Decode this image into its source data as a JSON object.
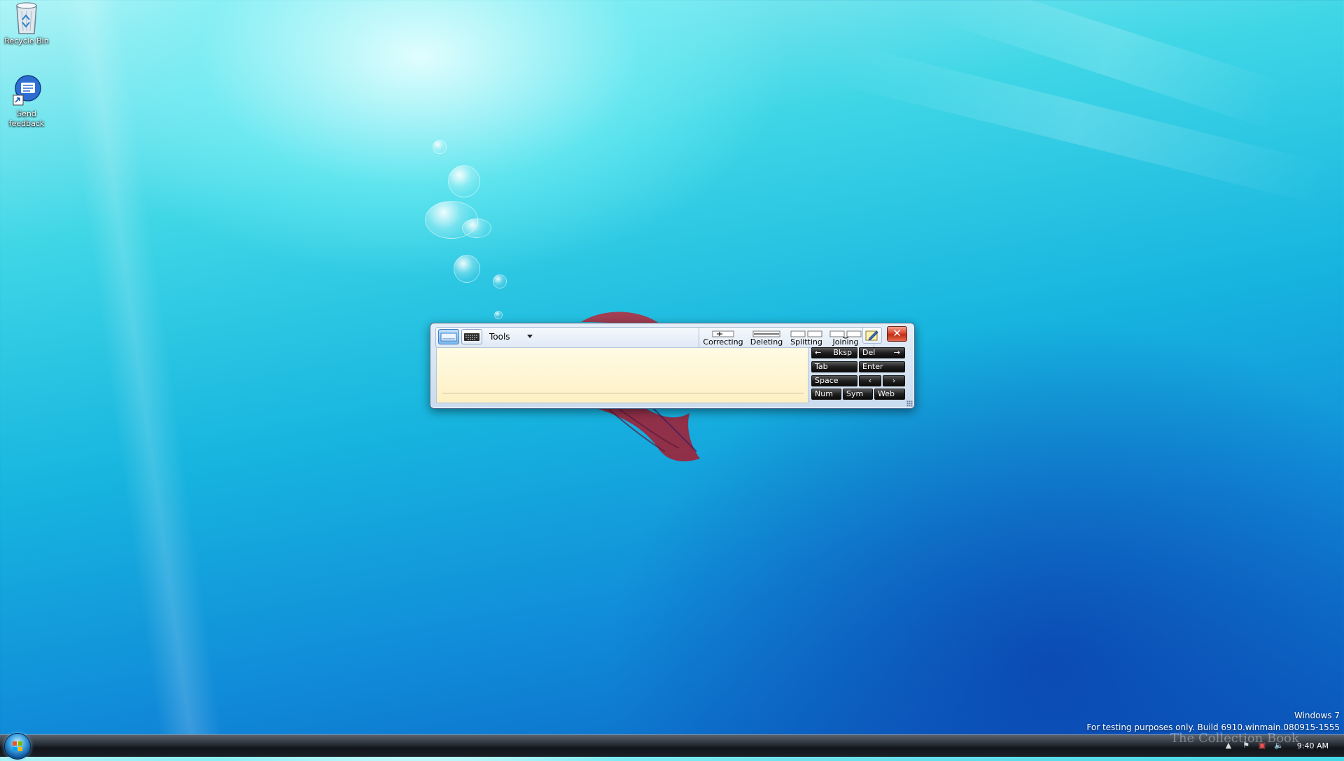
{
  "desktop": {
    "icons": [
      {
        "label": "Recycle Bin"
      },
      {
        "label": "Send feedback"
      }
    ]
  },
  "tip": {
    "toolbar": {
      "tools_label": "Tools",
      "gestures": [
        "Correcting",
        "Deleting",
        "Splitting",
        "Joining"
      ]
    },
    "keys": {
      "bksp": "Bksp",
      "del": "Del",
      "tab": "Tab",
      "enter": "Enter",
      "space": "Space",
      "left": "‹",
      "right": "›",
      "num": "Num",
      "sym": "Sym",
      "web": "Web"
    }
  },
  "watermark": {
    "os": "Windows 7",
    "build": "For testing purposes only. Build 6910.winmain.080915-1555"
  },
  "branding": "The Collection Book",
  "taskbar": {
    "clock": "9:40 AM"
  },
  "colors": {
    "close_button": "#c12d15",
    "writing_pad": "#fdf0c4",
    "key_face": "#1f1f1f"
  }
}
